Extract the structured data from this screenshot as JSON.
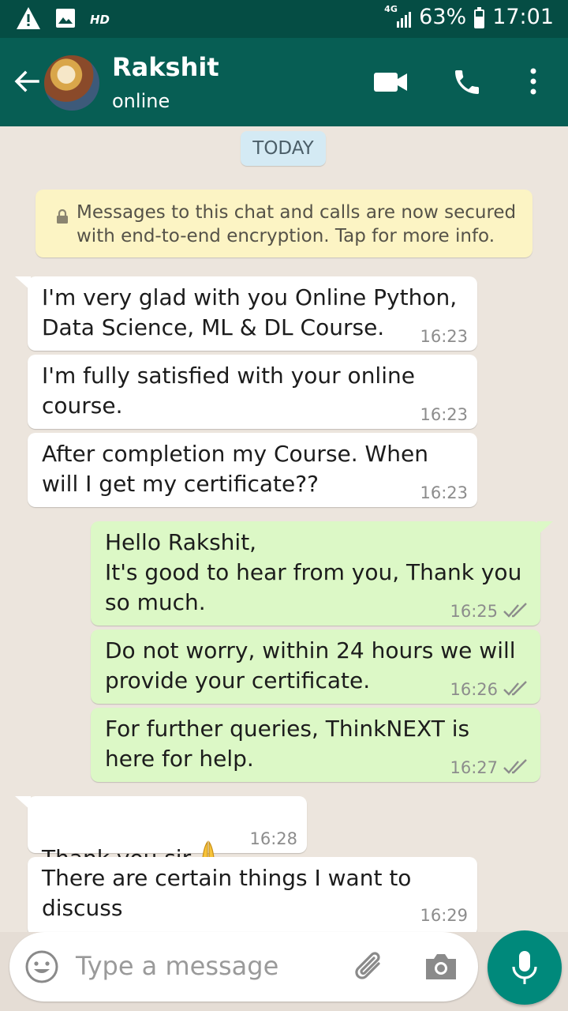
{
  "status_bar": {
    "hd_label": "HD",
    "network": "4G",
    "battery": "63%",
    "battery_level": 0.63,
    "time": "17:01",
    "icons": [
      "alert-icon",
      "image-icon",
      "signal-icon",
      "battery-icon"
    ]
  },
  "header": {
    "contact_name": "Rakshit",
    "presence": "online",
    "icons": [
      "back-arrow-icon",
      "video-call-icon",
      "phone-icon",
      "more-vert-icon"
    ],
    "color": "#075e54"
  },
  "chat": {
    "date_chip": "TODAY",
    "encryption_notice": "Messages to this chat and calls are now secured with end-to-end encryption. Tap for more info.",
    "messages": [
      {
        "dir": "in",
        "text": "I'm very glad with you Online Python,\nData Science, ML & DL Course.",
        "time": "16:23"
      },
      {
        "dir": "in",
        "text": "I'm fully satisfied with your online\ncourse.",
        "time": "16:23"
      },
      {
        "dir": "in",
        "text": "After completion my Course. When\nwill I get my certificate??",
        "time": "16:23"
      },
      {
        "dir": "out",
        "text": "Hello Rakshit,\nIt's good to hear from you, Thank you\nso much.",
        "time": "16:25",
        "status": "read"
      },
      {
        "dir": "out",
        "text": "Do not worry, within 24 hours we will\nprovide your certificate.",
        "time": "16:26",
        "status": "read"
      },
      {
        "dir": "out",
        "text": "For further queries, ThinkNEXT is\nhere for help.",
        "time": "16:27",
        "status": "read"
      },
      {
        "dir": "in",
        "text": "Thank you sir",
        "emoji": "folded-hands",
        "time": "16:28"
      },
      {
        "dir": "in",
        "text": "There are certain things I want to\ndiscuss",
        "time": "16:29"
      }
    ],
    "colors": {
      "incoming": "#ffffff",
      "outgoing": "#dcf8c6",
      "ticks": "#8c8c8c"
    }
  },
  "composer": {
    "placeholder": "Type a message",
    "icons": [
      "emoji-icon",
      "attach-icon",
      "camera-icon",
      "mic-icon"
    ],
    "mic_color": "#00897b"
  }
}
